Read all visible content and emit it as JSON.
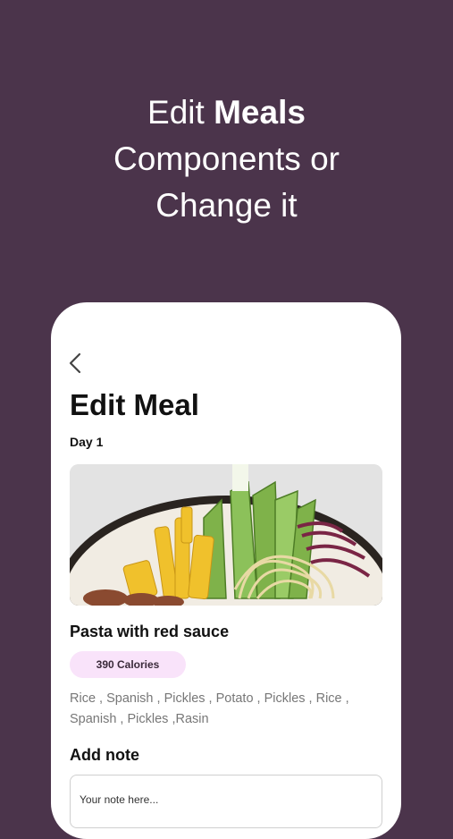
{
  "hero": {
    "line1_prefix": "Edit ",
    "line1_bold": "Meals",
    "line2": "Components or",
    "line3": "Change it"
  },
  "screen": {
    "back_icon": "chevron-left-icon",
    "title": "Edit Meal",
    "day": "Day 1",
    "meal_name": "Pasta with red sauce",
    "calories": "390 Calories",
    "ingredients_line1": "Rice , Spanish , Pickles , Potato , Pickles , Rice ,",
    "ingredients_line2": "Spanish , Pickles ,Rasin",
    "note_label": "Add note",
    "note_placeholder": "Your note here..."
  },
  "colors": {
    "background": "#4b344b",
    "card": "#ffffff",
    "badge": "#f9e3fa"
  }
}
